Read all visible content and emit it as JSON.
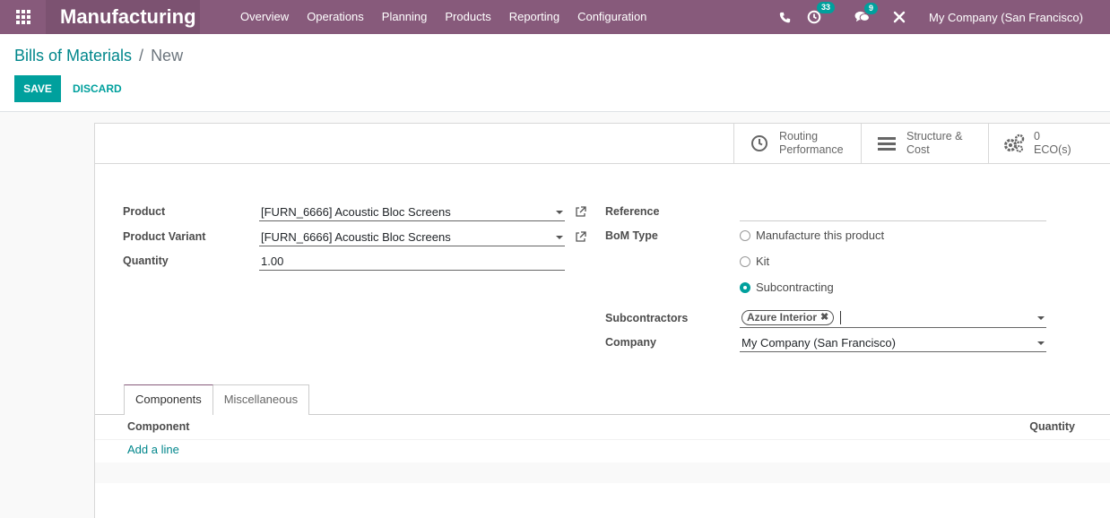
{
  "navbar": {
    "app_name": "Manufacturing",
    "menu": [
      "Overview",
      "Operations",
      "Planning",
      "Products",
      "Reporting",
      "Configuration"
    ],
    "activity_count": "33",
    "message_count": "9",
    "company": "My Company (San Francisco)"
  },
  "breadcrumb": {
    "parent": "Bills of Materials",
    "separator": "/",
    "current": "New"
  },
  "actions": {
    "save": "SAVE",
    "discard": "DISCARD"
  },
  "stat_buttons": {
    "routing": {
      "line1": "Routing",
      "line2": "Performance"
    },
    "structure": {
      "line1": "Structure &",
      "line2": "Cost"
    },
    "eco": {
      "count": "0",
      "label": "ECO(s)"
    }
  },
  "form": {
    "product_label": "Product",
    "product_value": "[FURN_6666] Acoustic Bloc Screens",
    "variant_label": "Product Variant",
    "variant_value": "[FURN_6666] Acoustic Bloc Screens",
    "quantity_label": "Quantity",
    "quantity_value": "1.00",
    "reference_label": "Reference",
    "reference_value": "",
    "bom_type_label": "BoM Type",
    "bom_type_options": [
      "Manufacture this product",
      "Kit",
      "Subcontracting"
    ],
    "bom_type_selected": "Subcontracting",
    "subcontractors_label": "Subcontractors",
    "subcontractor_tag": "Azure Interior",
    "company_label": "Company",
    "company_value": "My Company (San Francisco)"
  },
  "tabs": [
    "Components",
    "Miscellaneous"
  ],
  "components_list": {
    "col_component": "Component",
    "col_quantity": "Quantity",
    "add_line": "Add a line"
  }
}
